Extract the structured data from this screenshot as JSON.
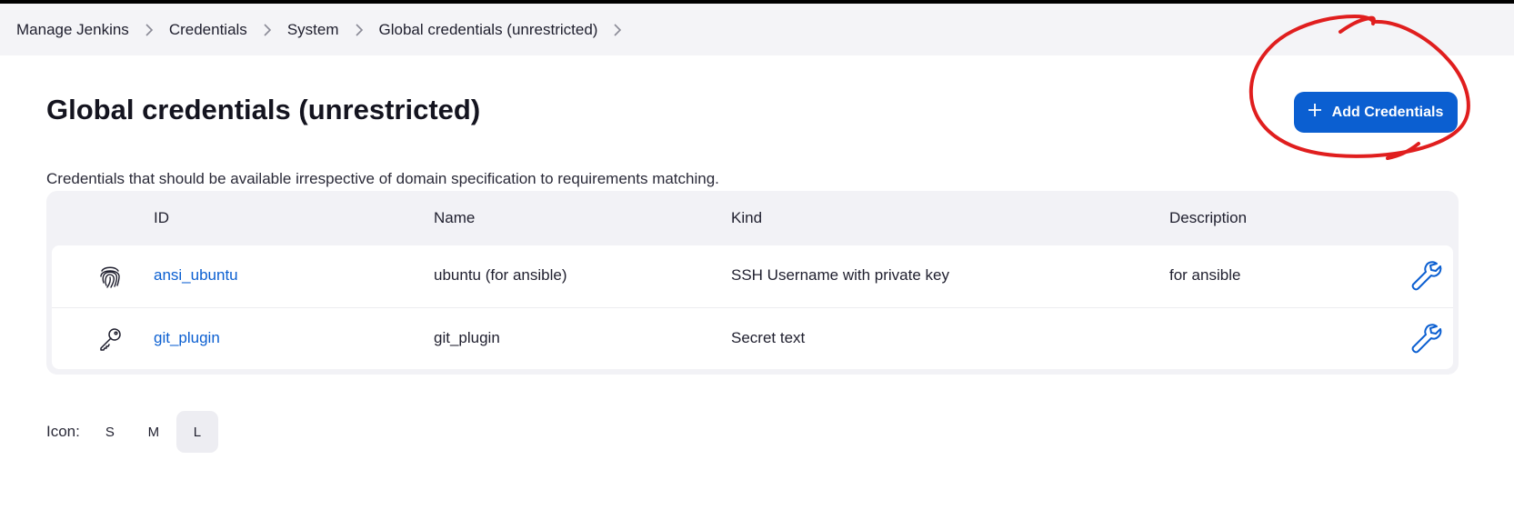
{
  "breadcrumb": {
    "items": [
      "Manage Jenkins",
      "Credentials",
      "System",
      "Global credentials (unrestricted)"
    ]
  },
  "page": {
    "title": "Global credentials (unrestricted)",
    "description": "Credentials that should be available irrespective of domain specification to requirements matching."
  },
  "actions": {
    "add_credentials_label": "Add Credentials",
    "add_icon": "plus-icon"
  },
  "annotation": {
    "color": "#e01e1e",
    "shape": "hand-drawn-circle"
  },
  "table": {
    "columns": [
      "ID",
      "Name",
      "Kind",
      "Description"
    ],
    "rows": [
      {
        "icon": "fingerprint-icon",
        "id": "ansi_ubuntu",
        "name": "ubuntu (for ansible)",
        "kind": "SSH Username with private key",
        "description": "for ansible",
        "action_icon": "wrench-icon"
      },
      {
        "icon": "key-icon",
        "id": "git_plugin",
        "name": "git_plugin",
        "kind": "Secret text",
        "description": "",
        "action_icon": "wrench-icon"
      }
    ]
  },
  "icon_size": {
    "label": "Icon:",
    "options": [
      "S",
      "M",
      "L"
    ],
    "selected": "L"
  },
  "colors": {
    "accent": "#0b5fd1",
    "breadcrumb_bg": "#f4f4f7",
    "table_bg": "#f2f2f6"
  }
}
